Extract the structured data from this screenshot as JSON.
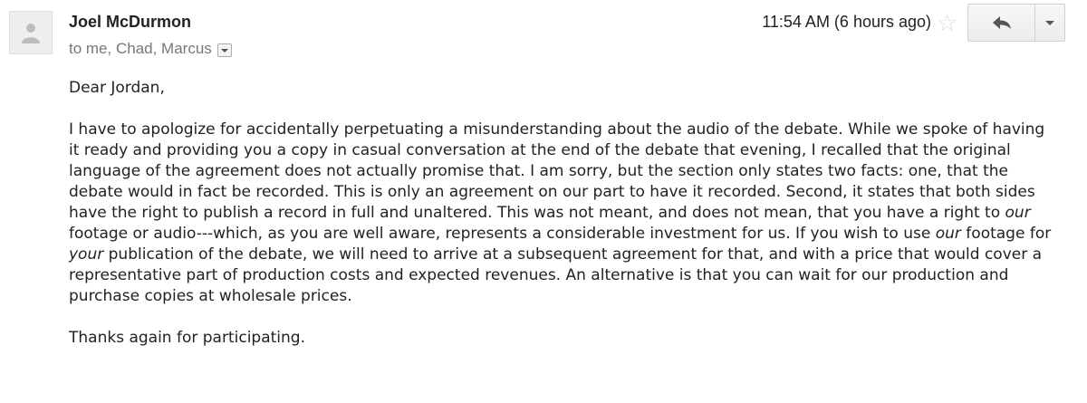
{
  "sender": {
    "name": "Joel McDurmon",
    "recipients": "to me, Chad, Marcus"
  },
  "header": {
    "timestamp": "11:54 AM (6 hours ago)"
  },
  "icons": {
    "avatar": "person-icon",
    "star": "star-icon",
    "reply": "reply-arrow-icon",
    "more": "chevron-down-icon",
    "details": "details-dropdown-icon"
  },
  "message": {
    "greeting": "Dear Jordan,",
    "p1_a": "I have to apologize for accidentally perpetuating a misunderstanding about the audio of the debate. While we spoke of having it ready and providing you a copy in casual conversation at the end of the debate that evening, I recalled that the original language of the agreement does not actually promise that. I am sorry, but the section only states two facts: one, that the debate would in fact be recorded. This is only an agreement on our part to have it recorded. Second, it states that both sides have the right to publish a record in full and unaltered. This was not meant, and does not mean, that you have a right to ",
    "p1_em1": "our",
    "p1_b": " footage or audio---which, as you are well aware, represents a considerable investment for us. If you wish to use ",
    "p1_em2": "our",
    "p1_c": " footage for ",
    "p1_em3": "your",
    "p1_d": " publication of the debate, we will need to arrive at a subsequent agreement for that, and with a price that would cover a representative part of production costs and expected revenues. An alternative is that you can wait for our production and purchase copies at wholesale prices.",
    "closing": "Thanks again for participating."
  }
}
